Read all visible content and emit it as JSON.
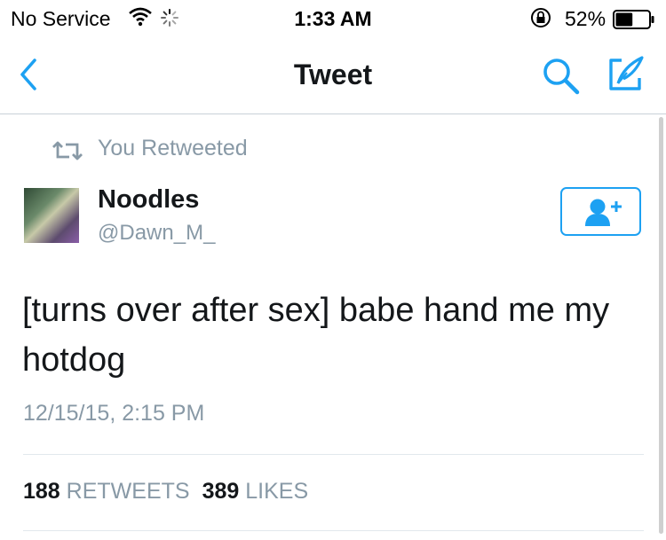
{
  "status_bar": {
    "carrier": "No Service",
    "time": "1:33 AM",
    "battery_percent": "52%",
    "battery_level": 0.52,
    "icons": [
      "wifi-icon",
      "loading-spinner-icon",
      "orientation-lock-icon",
      "battery-icon"
    ]
  },
  "nav": {
    "title": "Tweet",
    "icons": [
      "back-chevron-icon",
      "search-icon",
      "compose-icon"
    ]
  },
  "retweet_context": {
    "label": "You Retweeted",
    "icon": "retweet-icon"
  },
  "tweet": {
    "author_name": "Noodles",
    "author_handle": "@Dawn_M_",
    "text": "[turns over after sex] babe hand me my hotdog",
    "timestamp": "12/15/15, 2:15 PM",
    "retweet_count": "188",
    "retweet_label": "RETWEETS",
    "like_count": "389",
    "like_label": "LIKES",
    "follow_icon": "add-user-icon"
  },
  "colors": {
    "accent": "#1da1f2",
    "secondary_text": "#8899a6",
    "primary_text": "#14171a",
    "divider": "#e1e8ed"
  }
}
